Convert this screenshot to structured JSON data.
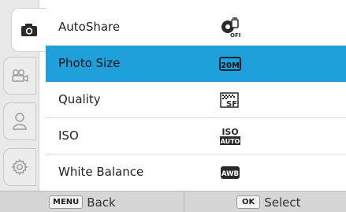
{
  "tabs": [
    {
      "name": "camera",
      "icon": "camera-icon",
      "active": true
    },
    {
      "name": "video",
      "icon": "video-camera-icon",
      "active": false
    },
    {
      "name": "user",
      "icon": "person-icon",
      "active": false
    },
    {
      "name": "settings",
      "icon": "gear-icon",
      "active": false
    }
  ],
  "menu": {
    "items": [
      {
        "label": "AutoShare",
        "value_icon": "autoshare-off-icon",
        "selected": false
      },
      {
        "label": "Photo Size",
        "value_icon": "photo-size-20m-icon",
        "value_text": "20M",
        "selected": true
      },
      {
        "label": "Quality",
        "value_icon": "quality-superfine-icon",
        "value_text": "SF",
        "selected": false
      },
      {
        "label": "ISO",
        "value_icon": "iso-auto-icon",
        "value_text": "ISO AUTO",
        "selected": false
      },
      {
        "label": "White Balance",
        "value_icon": "white-balance-auto-icon",
        "value_text": "AWB",
        "selected": false
      }
    ]
  },
  "bottom_bar": {
    "back_key": "MENU",
    "back_label": "Back",
    "select_key": "OK",
    "select_label": "Select"
  },
  "colors": {
    "selection": "#1ea0db",
    "background": "#ffffff",
    "tab_strip": "#e9e9e9",
    "bottom_bar": "#d6d6d6"
  }
}
